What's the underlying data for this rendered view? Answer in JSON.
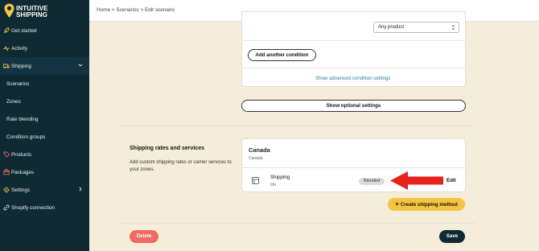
{
  "brand": {
    "line1": "INTUITIVE",
    "line2": "SHIPPING"
  },
  "colors": {
    "sidebar": "#0f2a33",
    "page_bg": "#f5ecd9",
    "accent_yellow": "#f5c542",
    "delete_red": "#f06a65",
    "link": "#2b7ea1",
    "arrow": "#e8211b"
  },
  "sidebar": {
    "items": [
      {
        "label": "Get started",
        "icon": "rocket-icon"
      },
      {
        "label": "Activity",
        "icon": "activity-icon"
      },
      {
        "label": "Shipping",
        "icon": "truck-icon"
      },
      {
        "label": "Scenarios"
      },
      {
        "label": "Zones"
      },
      {
        "label": "Rate blending"
      },
      {
        "label": "Condition groups"
      },
      {
        "label": "Products",
        "icon": "tag-icon"
      },
      {
        "label": "Packages",
        "icon": "package-icon"
      },
      {
        "label": "Settings",
        "icon": "gear-icon"
      },
      {
        "label": "Shopify connection",
        "icon": "link-icon"
      }
    ]
  },
  "breadcrumb": "Home > Scenarios > Edit scenario",
  "conditions": {
    "select_value": "Any product",
    "add_condition_label": "Add another condition",
    "advanced_link": "Show advanced condition settings",
    "optional_settings_label": "Show optional settings"
  },
  "rates": {
    "title": "Shipping rates and services",
    "description": "Add custom shipping rates or carrier services to your zones.",
    "zone_name": "Canada",
    "zone_sub": "Canada",
    "method_name": "Shipping",
    "method_status": "On",
    "badge": "Blended",
    "edit_label": "Edit",
    "create_label": "Create shipping method"
  },
  "footer": {
    "delete_label": "Delete",
    "save_label": "Save"
  }
}
